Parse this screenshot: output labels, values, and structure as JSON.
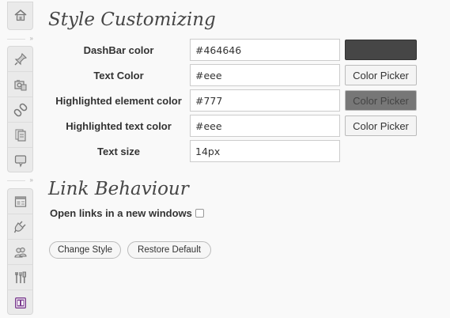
{
  "sidebar": {
    "group1": [
      {
        "icon": "dashboard-icon"
      }
    ],
    "group2": [
      {
        "icon": "pin-icon"
      },
      {
        "icon": "media-icon"
      },
      {
        "icon": "link-icon"
      },
      {
        "icon": "pages-icon"
      },
      {
        "icon": "comments-icon"
      }
    ],
    "group3": [
      {
        "icon": "appearance-icon"
      },
      {
        "icon": "plugins-icon"
      },
      {
        "icon": "users-icon"
      },
      {
        "icon": "tools-icon"
      },
      {
        "icon": "settings-icon"
      }
    ]
  },
  "style_section": {
    "title": "Style Customizing",
    "fields": [
      {
        "label": "DashBar color",
        "value": "#464646",
        "control": "swatch",
        "swatch_color": "#464646"
      },
      {
        "label": "Text Color",
        "value": "#eee",
        "control": "picker",
        "picker_label": "Color Picker"
      },
      {
        "label": "Highlighted element color",
        "value": "#777",
        "control": "picker-dark",
        "picker_label": "Color Picker"
      },
      {
        "label": "Highlighted text color",
        "value": "#eee",
        "control": "picker",
        "picker_label": "Color Picker"
      },
      {
        "label": "Text size",
        "value": "14px",
        "control": "none"
      }
    ]
  },
  "link_section": {
    "title": "Link Behaviour",
    "new_windows_label": "Open links in a new windows",
    "new_windows_checked": false
  },
  "buttons": {
    "change_style": "Change Style",
    "restore_default": "Restore Default"
  },
  "colors": {
    "dashbar": "#464646",
    "highlight": "#777",
    "active_menu": "#7a3b8e"
  }
}
